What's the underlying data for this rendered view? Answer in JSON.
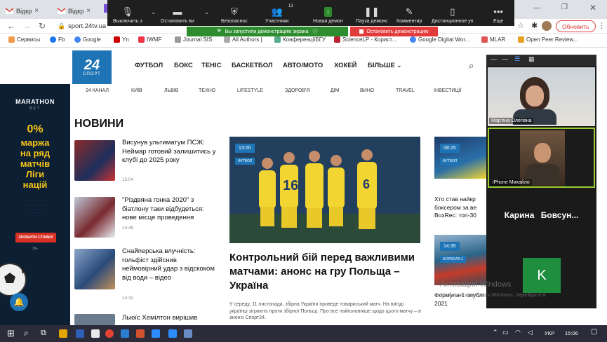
{
  "browser": {
    "tabs": [
      {
        "label": "Відкр",
        "close": "×"
      },
      {
        "label": "Відкр",
        "close": "×"
      }
    ],
    "url": "sport.24tv.ua",
    "update_button": "Обновить",
    "bookmarks": [
      "Сервисы",
      "Fb",
      "Google",
      "Yn",
      "IWMF",
      "Journal SIS",
      "All Authors |",
      "КонференціїБГУ",
      "ScienceLP - Корист...",
      "Google Digital Wor...",
      "MLAR",
      "Open Peer Review..."
    ]
  },
  "zoom": {
    "controls": [
      {
        "label": "Выключить з",
        "icon": "microphone-icon"
      },
      {
        "label": "Остановить ви",
        "icon": "camera-icon"
      },
      {
        "label": "Безопаснос",
        "icon": "shield-icon"
      },
      {
        "label": "Участники",
        "icon": "participants-icon",
        "count": "13"
      },
      {
        "label": "Новая демон",
        "icon": "share-icon"
      },
      {
        "label": "Пауза демонс",
        "icon": "pause-icon"
      },
      {
        "label": "Комментир",
        "icon": "pen-icon"
      },
      {
        "label": "Дистанционное уп",
        "icon": "mouse-icon"
      },
      {
        "label": "Еще",
        "icon": "more-icon"
      }
    ],
    "share_status": "Вы запустили демонстрацию экрана",
    "stop_share": "Остановить демонстрацию",
    "participants": [
      {
        "name": "Мар'яна Олегівна"
      },
      {
        "name": "iPhone Михайло"
      },
      {
        "name": "Карина Бовсун..."
      },
      {
        "name": "K"
      }
    ],
    "accent": "#2d8c2d",
    "stop_color": "#e23b3b"
  },
  "site": {
    "logo_number": "24",
    "logo_sub": "СПОРТ",
    "nav": [
      "ФУТБОЛ",
      "БОКС",
      "ТЕНІС",
      "БАСКЕТБОЛ",
      "АВТО/МОТО",
      "ХОКЕЙ",
      "БІЛЬШЕ"
    ],
    "subnav": [
      "24 КАНАЛ",
      "КИЇВ",
      "ЛЬВІВ",
      "ТЕХНО",
      "LIFESTYLE",
      "ЗДОРОВ'Я",
      "ДІМ",
      "ВИНО",
      "TRAVEL",
      "ІНВЕСТИЦІЇ"
    ],
    "news_heading": "НОВИНИ",
    "news": [
      {
        "title": "Висунув ультиматум ПСЖ: Неймар готовий залишитись у клубі до 2025 року",
        "time": "15:04"
      },
      {
        "title": "\"Різдвяна гонка 2020\" з біатлону таки відбудеться: нове місце проведення",
        "time": "14:45"
      },
      {
        "title": "Снайперська влучність: гольфіст здійснив неймовірний удар з відскоком від води – відео",
        "time": "14:32"
      },
      {
        "title": "Льюїс Хемілтон вирішив",
        "time": ""
      }
    ],
    "main": {
      "time": "13:00",
      "badge": "ФУТБОЛ",
      "title": "Контрольний бій перед важливими матчами: анонс на гру Польща – Україна",
      "lead": "У середу, 11 листопада, збірна України проведе товариський матч. На виїзді українці зіграють проти збірної Польщі. Про все найголовніше щодо цього матчу – в анонсі Спорт24."
    },
    "right_cards": [
      {
        "time": "08:25",
        "badge": "ФУТБОЛ",
        "title": "Хто став найкр боксером за ве BoxRec: топ-30"
      },
      {
        "time": "14:35",
        "badge": "ФОРМУЛА-1",
        "title": "Формула-1 опублі календар на 2021"
      }
    ],
    "ad": {
      "brand": "MARATHON",
      "brand_sub": "BET",
      "percent": "0%",
      "line1": "маржа",
      "line2": "на ряд",
      "line3": "матчів",
      "line4": "Ліги",
      "line5": "націй",
      "cta": "ЗРОБИТИ СТАВКУ",
      "age": "18+"
    },
    "activation_watermark": "Активация Windows",
    "activation_sub": "Чтобы активировать Windows, перейдите в"
  },
  "taskbar": {
    "lang": "УКР",
    "time": "15:06"
  }
}
